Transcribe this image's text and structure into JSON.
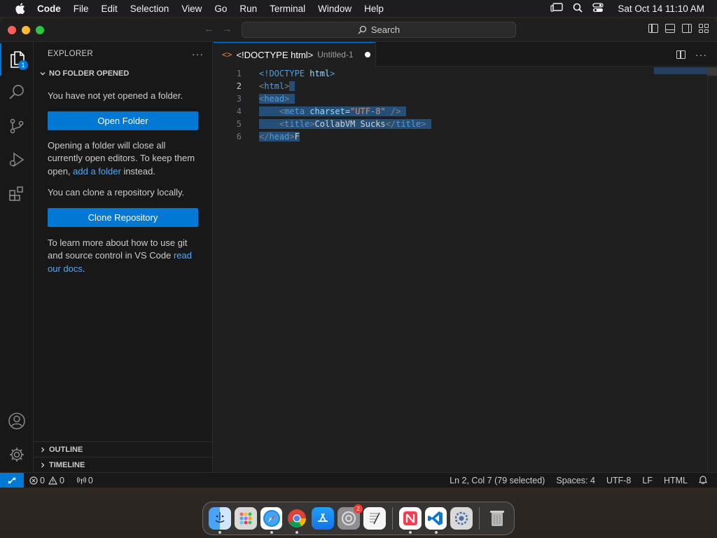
{
  "menubar": {
    "app_name": "Code",
    "items": [
      "File",
      "Edit",
      "Selection",
      "View",
      "Go",
      "Run",
      "Terminal",
      "Window",
      "Help"
    ],
    "clock": "Sat Oct 14  11:10 AM"
  },
  "titlebar": {
    "search_label": "Search"
  },
  "activity_bar": {
    "explorer_badge": "1",
    "items": [
      "explorer",
      "search",
      "source-control",
      "run-debug",
      "extensions"
    ],
    "bottom_items": [
      "accounts",
      "manage"
    ]
  },
  "sidebar": {
    "header": "EXPLORER",
    "more": "···",
    "section_title": "NO FOLDER OPENED",
    "intro_text": "You have not yet opened a folder.",
    "open_folder_button": "Open Folder",
    "info_text_1": "Opening a folder will close all currently open editors. To keep them open, ",
    "info_link": "add a folder",
    "info_text_2": " instead.",
    "clone_text": "You can clone a repository locally.",
    "clone_button": "Clone Repository",
    "learn_text": "To learn more about how to use git and source control in VS Code ",
    "learn_link": "read our docs",
    "learn_end": ".",
    "outline_title": "OUTLINE",
    "timeline_title": "TIMELINE"
  },
  "editor": {
    "tab": {
      "title": "<!DOCTYPE html>",
      "description": "Untitled-1"
    },
    "line_numbers": [
      "1",
      "2",
      "3",
      "4",
      "5",
      "6"
    ],
    "current_line": "2",
    "lines": {
      "l1_bang": "<!DOCTYPE",
      "l1_html": " html",
      "l1_close": ">",
      "l2_open": "<",
      "l2_tag": "html",
      "l2_close": ">",
      "l3_open": "<",
      "l3_tag": "head",
      "l3_close": ">",
      "l4_indent": "    ",
      "l4_open": "<",
      "l4_tag": "meta",
      "l4_attr": " charset",
      "l4_eq": "=",
      "l4_str": "\"UTF-8\"",
      "l4_close": " />",
      "l5_indent": "    ",
      "l5_open": "<",
      "l5_tag": "title",
      "l5_gt": ">",
      "l5_text": "CollabVM Sucks",
      "l5_endopen": "</",
      "l5_endtag": "title",
      "l5_endgt": ">",
      "l6_open": "</",
      "l6_tag": "head",
      "l6_gt": ">",
      "l6_text": "F"
    }
  },
  "statusbar": {
    "errors": "0",
    "warnings": "0",
    "ports": "0",
    "position": "Ln 2, Col 7 (79 selected)",
    "spaces": "Spaces: 4",
    "encoding": "UTF-8",
    "eol": "LF",
    "language": "HTML"
  },
  "dock": {
    "apps": [
      "Finder",
      "Launchpad",
      "Safari",
      "Chrome",
      "App Store",
      "System Settings",
      "TextEdit",
      "News",
      "Visual Studio Code",
      "System Settings Alt",
      "Trash"
    ],
    "settings_badge": "2"
  },
  "colors": {
    "accent": "#0078d4",
    "link": "#4daafc",
    "selection": "#264f78"
  }
}
